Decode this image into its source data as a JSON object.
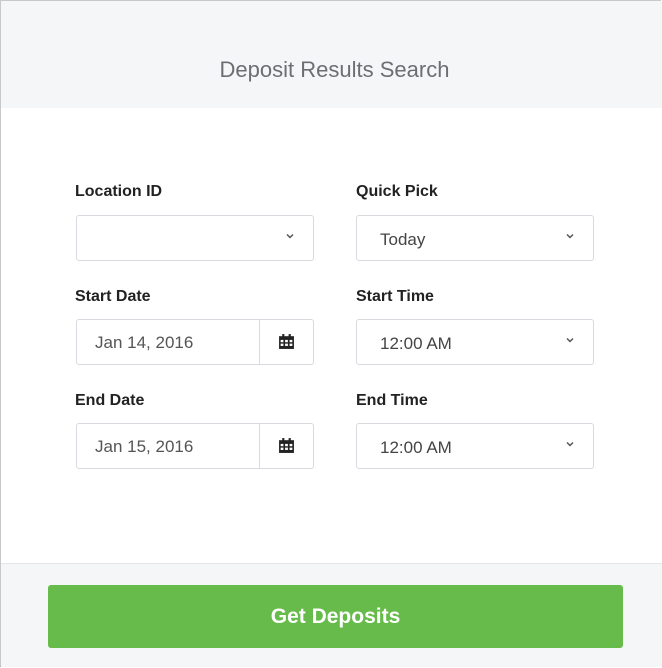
{
  "header": {
    "title": "Deposit Results Search"
  },
  "form": {
    "location": {
      "label": "Location ID",
      "value": ""
    },
    "quick_pick": {
      "label": "Quick Pick",
      "value": "Today"
    },
    "start_date": {
      "label": "Start Date",
      "value": "Jan 14, 2016"
    },
    "start_time": {
      "label": "Start Time",
      "value": "12:00 AM"
    },
    "end_date": {
      "label": "End Date",
      "value": "Jan 15, 2016"
    },
    "end_time": {
      "label": "End Time",
      "value": "12:00 AM"
    }
  },
  "footer": {
    "submit_label": "Get Deposits"
  },
  "colors": {
    "accent": "#66bb4a",
    "header_bg": "#f5f6f8",
    "border": "#d7dbe0"
  }
}
